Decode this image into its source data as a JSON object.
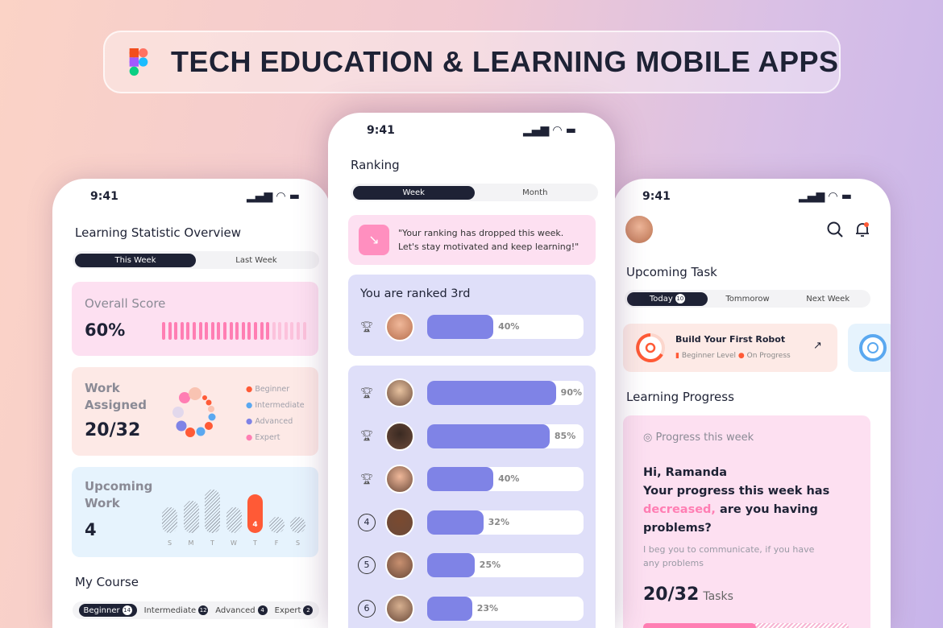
{
  "banner": {
    "title": "TECH EDUCATION & LEARNING MOBILE APPS",
    "logo": "figma-logo"
  },
  "colors": {
    "navy": "#1e2235",
    "pink": "#ff7eb3",
    "orange": "#ff5a36",
    "purple": "#7f83e6",
    "blue": "#5aa8f0"
  },
  "left": {
    "time": "9:41",
    "title": "Learning Statistic Overview",
    "tabs": [
      "This Week",
      "Last Week"
    ],
    "overall": {
      "label": "Overall Score",
      "value": "60%",
      "progress": 0.6
    },
    "work": {
      "label1": "Work",
      "label2": "Assigned",
      "value": "20/32",
      "legend": [
        {
          "name": "Beginner",
          "color": "#ff5a36"
        },
        {
          "name": "Intermediate",
          "color": "#5aa8f0"
        },
        {
          "name": "Advanced",
          "color": "#7f83e6"
        },
        {
          "name": "Expert",
          "color": "#ff7eb3"
        }
      ]
    },
    "upcoming": {
      "label1": "Upcoming",
      "label2": "Work",
      "value": "4",
      "days": [
        "S",
        "M",
        "T",
        "W",
        "T",
        "F",
        "S"
      ],
      "active_label": "4"
    },
    "course": {
      "title": "My Course",
      "tabs": [
        {
          "label": "Beginner",
          "count": "14"
        },
        {
          "label": "Intermediate",
          "count": "12"
        },
        {
          "label": "Advanced",
          "count": "4"
        },
        {
          "label": "Expert",
          "count": "2"
        }
      ]
    }
  },
  "center": {
    "time": "9:41",
    "title": "Ranking",
    "tabs": [
      "Week",
      "Month"
    ],
    "alert": {
      "line1": "\"Your ranking has dropped this week.",
      "line2": "Let's stay motivated and keep learning!\""
    },
    "you": {
      "title": "You are ranked 3rd",
      "rank": "3",
      "pct": "40%",
      "value": 40
    },
    "list": [
      {
        "rank": "1",
        "pct": "90%",
        "value": 90
      },
      {
        "rank": "2",
        "pct": "85%",
        "value": 85
      },
      {
        "rank": "3",
        "pct": "40%",
        "value": 40
      },
      {
        "rank": "4",
        "pct": "32%",
        "value": 32
      },
      {
        "rank": "5",
        "pct": "25%",
        "value": 25
      },
      {
        "rank": "6",
        "pct": "23%",
        "value": 23
      }
    ]
  },
  "right": {
    "time": "9:41",
    "title": "Upcoming Task",
    "tabs": [
      {
        "label": "Today",
        "count": "10"
      },
      {
        "label": "Tommorow"
      },
      {
        "label": "Next Week"
      }
    ],
    "task": {
      "title": "Build Your First Robot",
      "level": "Beginner Level",
      "status": "On Progress"
    },
    "progress_title": "Learning Progress",
    "progress": {
      "header": "Progress this week",
      "greeting": "Hi, Ramanda",
      "msg1": "Your progress this week has",
      "highlight": "decreased,",
      "msg2": " are you having",
      "msg3": "problems?",
      "sub1": "I beg you to communicate, if you have",
      "sub2": "any problems",
      "count": "20/32",
      "unit": "Tasks",
      "value": 0.625
    }
  }
}
